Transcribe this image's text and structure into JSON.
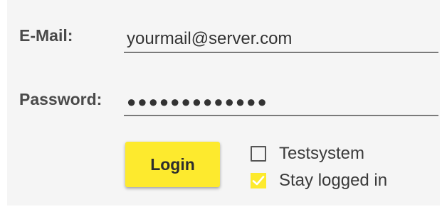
{
  "form": {
    "email": {
      "label": "E-Mail:",
      "value": "yourmail@server.com"
    },
    "password": {
      "label": "Password:",
      "masked_value": "●●●●●●●●●●●●●"
    },
    "login_button": "Login",
    "options": [
      {
        "label": "Testsystem",
        "checked": false
      },
      {
        "label": "Stay logged in",
        "checked": true
      }
    ]
  },
  "colors": {
    "accent": "#fdea2e",
    "panel_bg": "#f5f5f5",
    "underline": "#7a7a7a"
  }
}
